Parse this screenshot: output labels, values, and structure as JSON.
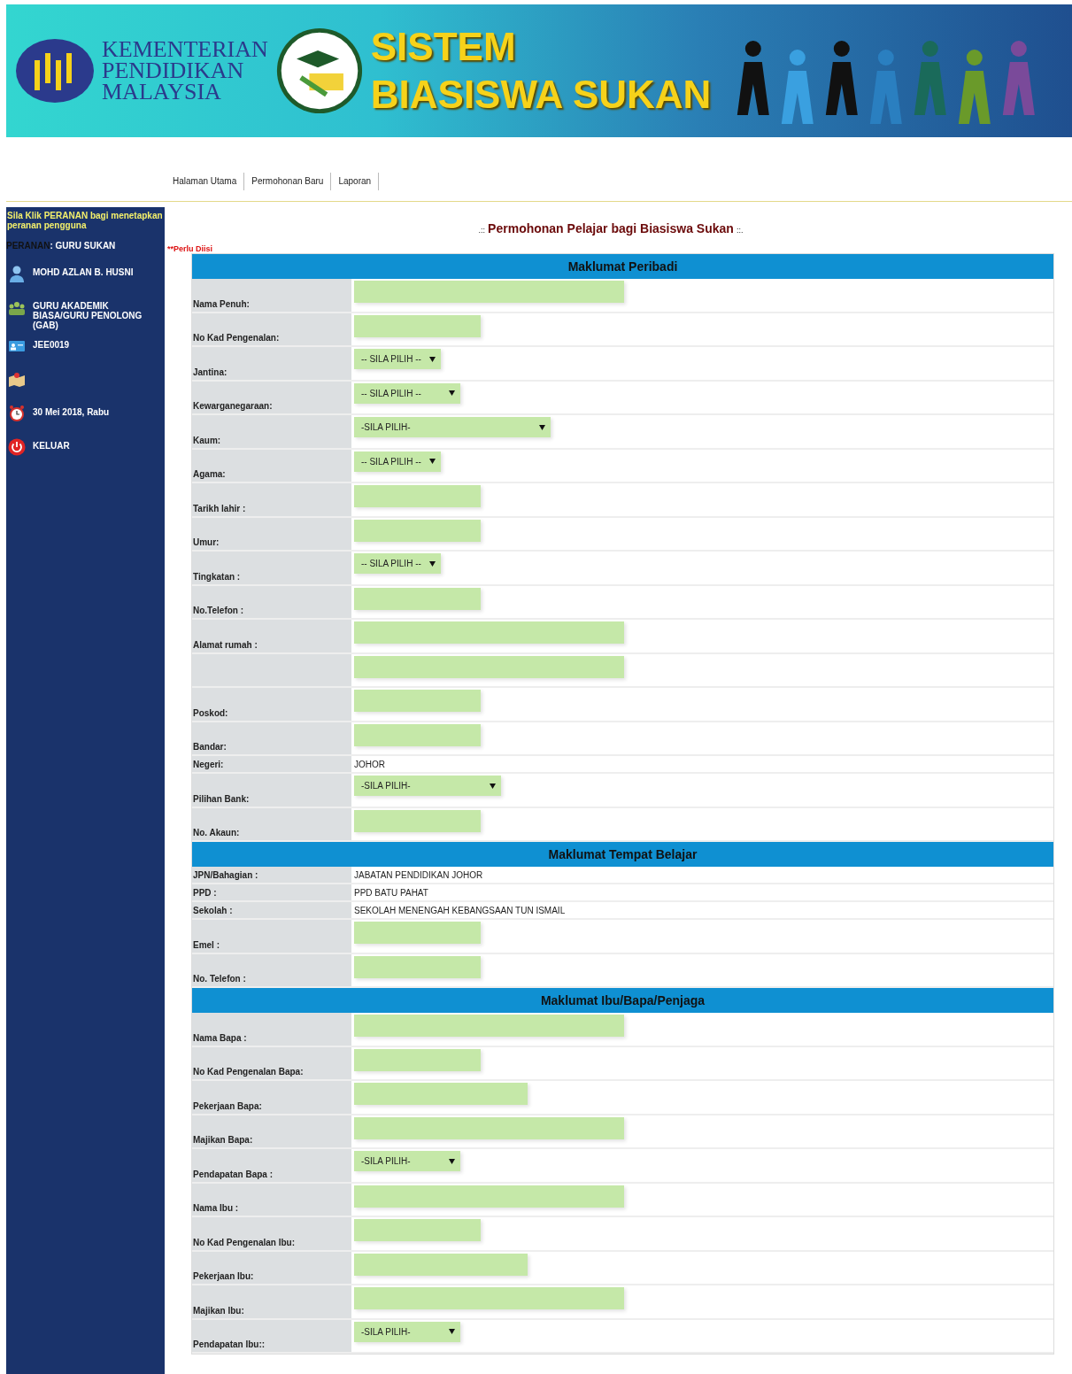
{
  "header": {
    "ministry": [
      "KEMENTERIAN",
      "PENDIDIKAN",
      "MALAYSIA"
    ],
    "system_title": [
      "SISTEM",
      "BIASISWA SUKAN"
    ]
  },
  "nav": [
    {
      "label": "Halaman Utama"
    },
    {
      "label": "Permohonan Baru"
    },
    {
      "label": "Laporan"
    }
  ],
  "sidebar": {
    "notice": "Sila Klik PERANAN bagi menetapkan peranan pengguna",
    "role_label": "PERANAN",
    "role_value": ": GURU SUKAN",
    "items": [
      {
        "kind": "user",
        "label": "MOHD AZLAN B. HUSNI"
      },
      {
        "kind": "group",
        "label": "GURU AKADEMIK BIASA/GURU PENOLONG (GAB)"
      },
      {
        "kind": "card",
        "label": "JEE0019"
      },
      {
        "kind": "map"
      },
      {
        "kind": "clock",
        "label": "30 Mei 2018, Rabu"
      },
      {
        "kind": "power",
        "label": "KELUAR"
      }
    ]
  },
  "page_title": {
    "prefix": ".::",
    "text": "Permohonan Pelajar bagi Biasiswa Sukan",
    "suffix": "::."
  },
  "required_note": "**Perlu Diisi",
  "sections": [
    {
      "title": "Maklumat Peribadi",
      "rows": [
        {
          "label": "Nama Penuh:",
          "kind": "longtext"
        },
        {
          "label": "No Kad Pengenalan:",
          "kind": "shorttext"
        },
        {
          "label": "Jantina:",
          "kind": "select",
          "value": "-- SILA PILIH --"
        },
        {
          "label": "Kewarganegaraan:",
          "kind": "midselect",
          "value": "-- SILA PILIH --"
        },
        {
          "label": "Kaum:",
          "kind": "longselect",
          "value": "-SILA PILIH-"
        },
        {
          "label": "Agama:",
          "kind": "select",
          "value": "-- SILA PILIH --"
        },
        {
          "label": "Tarikh lahir :",
          "kind": "shorttext"
        },
        {
          "label": "Umur:",
          "kind": "shorttext"
        },
        {
          "label": "Tingkatan :",
          "kind": "select",
          "value": "-- SILA PILIH --"
        },
        {
          "label": "No.Telefon :",
          "kind": "shorttext"
        },
        {
          "label": "Alamat rumah :",
          "kind": "longtext"
        },
        {
          "kind": "longtext"
        },
        {
          "label": "Poskod:",
          "kind": "shorttext"
        },
        {
          "label": "Bandar:",
          "kind": "shorttext"
        },
        {
          "label": "Negeri:",
          "kind": "static",
          "value": "JOHOR"
        },
        {
          "label": "Pilihan Bank:",
          "kind": "wideselect",
          "value": "-SILA PILIH-"
        },
        {
          "label": "No. Akaun:",
          "kind": "shorttext"
        }
      ]
    },
    {
      "title": "Maklumat Tempat Belajar",
      "rows": [
        {
          "label": "JPN/Bahagian :",
          "kind": "static",
          "value": "JABATAN PENDIDIKAN JOHOR"
        },
        {
          "label": "PPD :",
          "kind": "static",
          "value": "PPD BATU PAHAT"
        },
        {
          "label": "Sekolah :",
          "kind": "static",
          "value": "SEKOLAH MENENGAH KEBANGSAAN TUN ISMAIL"
        },
        {
          "label": "Emel :",
          "kind": "shorttext"
        },
        {
          "label": "No. Telefon :",
          "kind": "shorttext"
        }
      ]
    },
    {
      "title": "Maklumat Ibu/Bapa/Penjaga",
      "rows": [
        {
          "label": "Nama Bapa :",
          "kind": "longtext"
        },
        {
          "label": "No Kad Pengenalan Bapa:",
          "kind": "shorttext"
        },
        {
          "label": "Pekerjaan Bapa:",
          "kind": "midtext"
        },
        {
          "label": "Majikan Bapa:",
          "kind": "longtext"
        },
        {
          "label": "Pendapatan Bapa :",
          "kind": "midselect",
          "value": "-SILA PILIH-"
        },
        {
          "label": "Nama Ibu :",
          "kind": "longtext"
        },
        {
          "label": "No Kad Pengenalan Ibu:",
          "kind": "shorttext"
        },
        {
          "label": "Pekerjaan Ibu:",
          "kind": "midtext"
        },
        {
          "label": "Majikan Ibu:",
          "kind": "longtext"
        },
        {
          "label": "Pendapatan Ibu::",
          "kind": "midselect",
          "value": "-SILA PILIH-"
        }
      ]
    }
  ]
}
